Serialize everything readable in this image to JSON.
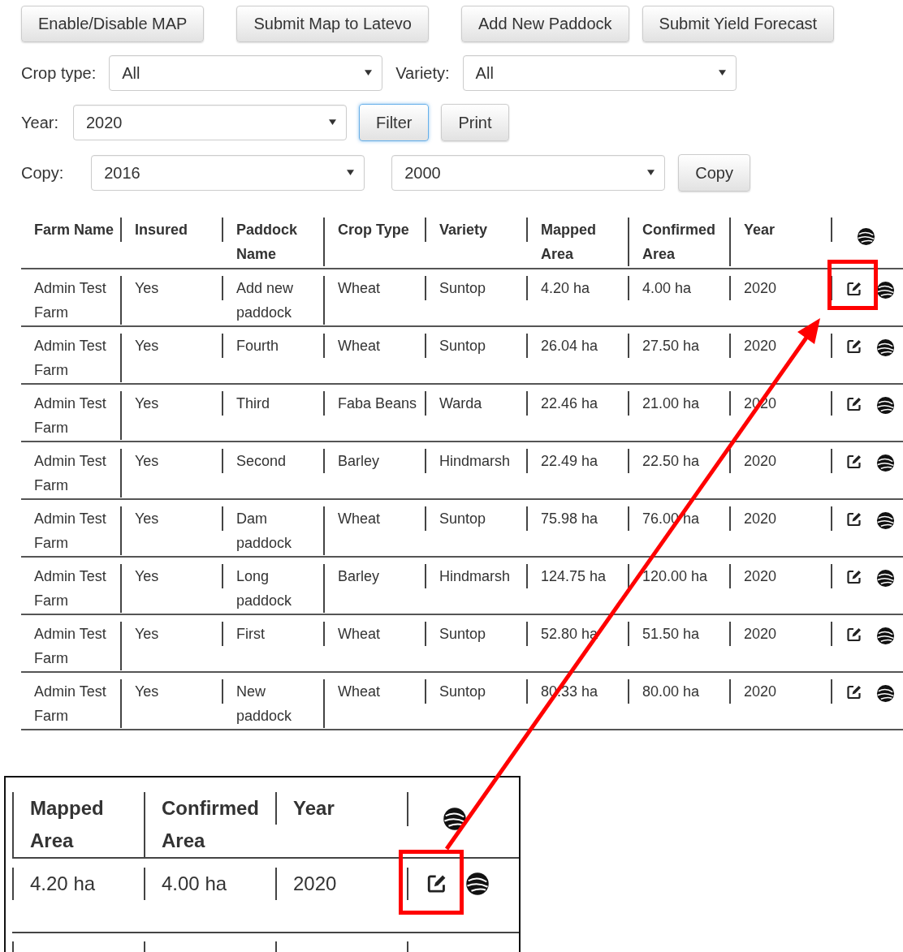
{
  "toolbar": [
    "Enable/Disable MAP",
    "Submit Map to Latevo",
    "Add New Paddock",
    "Submit Yield Forecast"
  ],
  "filters": {
    "crop_type": {
      "label": "Crop type:",
      "value": "All"
    },
    "variety": {
      "label": "Variety:",
      "value": "All"
    },
    "year": {
      "label": "Year:",
      "value": "2020"
    },
    "filter_button": {
      "label": "Filter",
      "focused": true
    },
    "print_button": {
      "label": "Print"
    },
    "copy": {
      "label": "Copy:",
      "from": "2016",
      "to": "2000",
      "button": "Copy"
    }
  },
  "table": {
    "columns": [
      "Farm Name",
      "Insured",
      "Paddock Name",
      "Crop Type",
      "Variety",
      "Mapped Area",
      "Confirmed Area",
      "Year"
    ],
    "rows": [
      {
        "cells": [
          "Admin Test Farm",
          "Yes",
          "Add new paddock",
          "Wheat",
          "Suntop",
          "4.20 ha",
          "4.00 ha",
          "2020"
        ],
        "highlighted": true
      },
      {
        "cells": [
          "Admin Test Farm",
          "Yes",
          "Fourth",
          "Wheat",
          "Suntop",
          "26.04 ha",
          "27.50 ha",
          "2020"
        ],
        "highlighted": false
      },
      {
        "cells": [
          "Admin Test Farm",
          "Yes",
          "Third",
          "Faba Beans",
          "Warda",
          "22.46 ha",
          "21.00 ha",
          "2020"
        ],
        "highlighted": false
      },
      {
        "cells": [
          "Admin Test Farm",
          "Yes",
          "Second",
          "Barley",
          "Hindmarsh",
          "22.49 ha",
          "22.50 ha",
          "2020"
        ],
        "highlighted": false
      },
      {
        "cells": [
          "Admin Test Farm",
          "Yes",
          "Dam paddock",
          "Wheat",
          "Suntop",
          "75.98 ha",
          "76.00 ha",
          "2020"
        ],
        "highlighted": false
      },
      {
        "cells": [
          "Admin Test Farm",
          "Yes",
          "Long paddock",
          "Barley",
          "Hindmarsh",
          "124.75 ha",
          "120.00 ha",
          "2020"
        ],
        "highlighted": false
      },
      {
        "cells": [
          "Admin Test Farm",
          "Yes",
          "First",
          "Wheat",
          "Suntop",
          "52.80 ha",
          "51.50 ha",
          "2020"
        ],
        "highlighted": false
      },
      {
        "cells": [
          "Admin Test Farm",
          "Yes",
          "New paddock",
          "Wheat",
          "Suntop",
          "80.33 ha",
          "80.00 ha",
          "2020"
        ],
        "highlighted": false
      }
    ]
  },
  "inset": {
    "columns": [
      "Mapped Area",
      "Confirmed Area",
      "Year"
    ],
    "rows": [
      {
        "cells": [
          "4.20 ha",
          "4.00 ha",
          "2020"
        ],
        "highlighted": true
      }
    ]
  }
}
